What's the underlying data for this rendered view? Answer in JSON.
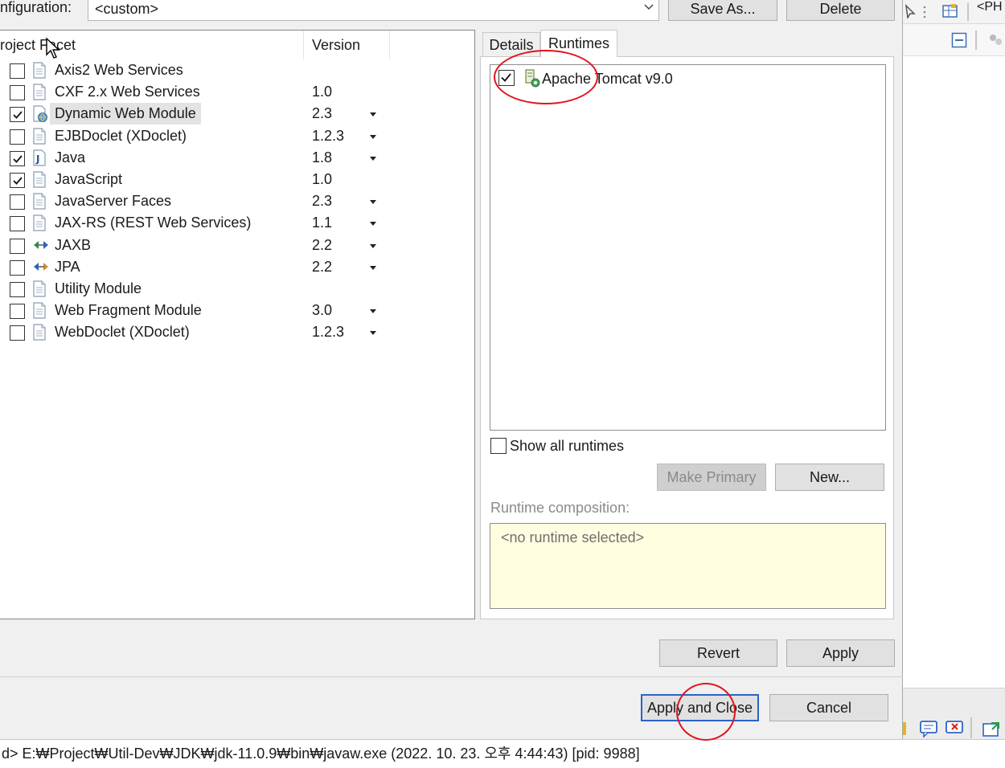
{
  "configuration": {
    "label": "nfiguration:",
    "value": "<custom>",
    "save_as_label": "Save As...",
    "delete_label": "Delete"
  },
  "facets_table": {
    "headers": {
      "facet": "roject Facet",
      "version": "Version"
    },
    "rows": [
      {
        "name": "Axis2 Web Services",
        "version": "",
        "checked": false,
        "icon": "document-icon",
        "dropdown": false
      },
      {
        "name": "CXF 2.x Web Services",
        "version": "1.0",
        "checked": false,
        "icon": "document-icon",
        "dropdown": false
      },
      {
        "name": "Dynamic Web Module",
        "version": "2.3",
        "checked": true,
        "icon": "web-module-icon",
        "dropdown": true,
        "selected": true
      },
      {
        "name": "EJBDoclet (XDoclet)",
        "version": "1.2.3",
        "checked": false,
        "icon": "document-icon",
        "dropdown": true
      },
      {
        "name": "Java",
        "version": "1.8",
        "checked": true,
        "icon": "java-icon",
        "dropdown": true
      },
      {
        "name": "JavaScript",
        "version": "1.0",
        "checked": true,
        "icon": "document-icon",
        "dropdown": false
      },
      {
        "name": "JavaServer Faces",
        "version": "2.3",
        "checked": false,
        "icon": "document-icon",
        "dropdown": true
      },
      {
        "name": "JAX-RS (REST Web Services)",
        "version": "1.1",
        "checked": false,
        "icon": "document-icon",
        "dropdown": true
      },
      {
        "name": "JAXB",
        "version": "2.2",
        "checked": false,
        "icon": "jaxb-arrows-icon",
        "dropdown": true
      },
      {
        "name": "JPA",
        "version": "2.2",
        "checked": false,
        "icon": "jpa-arrows-icon",
        "dropdown": true
      },
      {
        "name": "Utility Module",
        "version": "",
        "checked": false,
        "icon": "document-icon",
        "dropdown": false
      },
      {
        "name": "Web Fragment Module",
        "version": "3.0",
        "checked": false,
        "icon": "document-icon",
        "dropdown": true
      },
      {
        "name": "WebDoclet (XDoclet)",
        "version": "1.2.3",
        "checked": false,
        "icon": "document-icon",
        "dropdown": true
      }
    ]
  },
  "tabs": {
    "details": "Details",
    "runtimes": "Runtimes",
    "active": "runtimes"
  },
  "runtimes": {
    "items": [
      {
        "name": "Apache Tomcat v9.0",
        "checked": true
      }
    ],
    "show_all_label": "Show all runtimes",
    "show_all_checked": false,
    "make_primary_label": "Make Primary",
    "new_label": "New...",
    "composition_label": "Runtime composition:",
    "composition_empty": "<no runtime selected>"
  },
  "buttons": {
    "revert": "Revert",
    "apply": "Apply",
    "apply_close": "Apply and Close",
    "cancel": "Cancel"
  },
  "status_bar": {
    "text": "d> E:₩Project₩Util-Dev₩JDK₩jdk-11.0.9₩bin₩javaw.exe (2022. 10. 23. 오후 4:44:43) [pid: 9988]"
  },
  "colors": {
    "annotation": "#e2141c",
    "focus_border": "#2b63c6",
    "composition_bg": "#fffee0"
  }
}
